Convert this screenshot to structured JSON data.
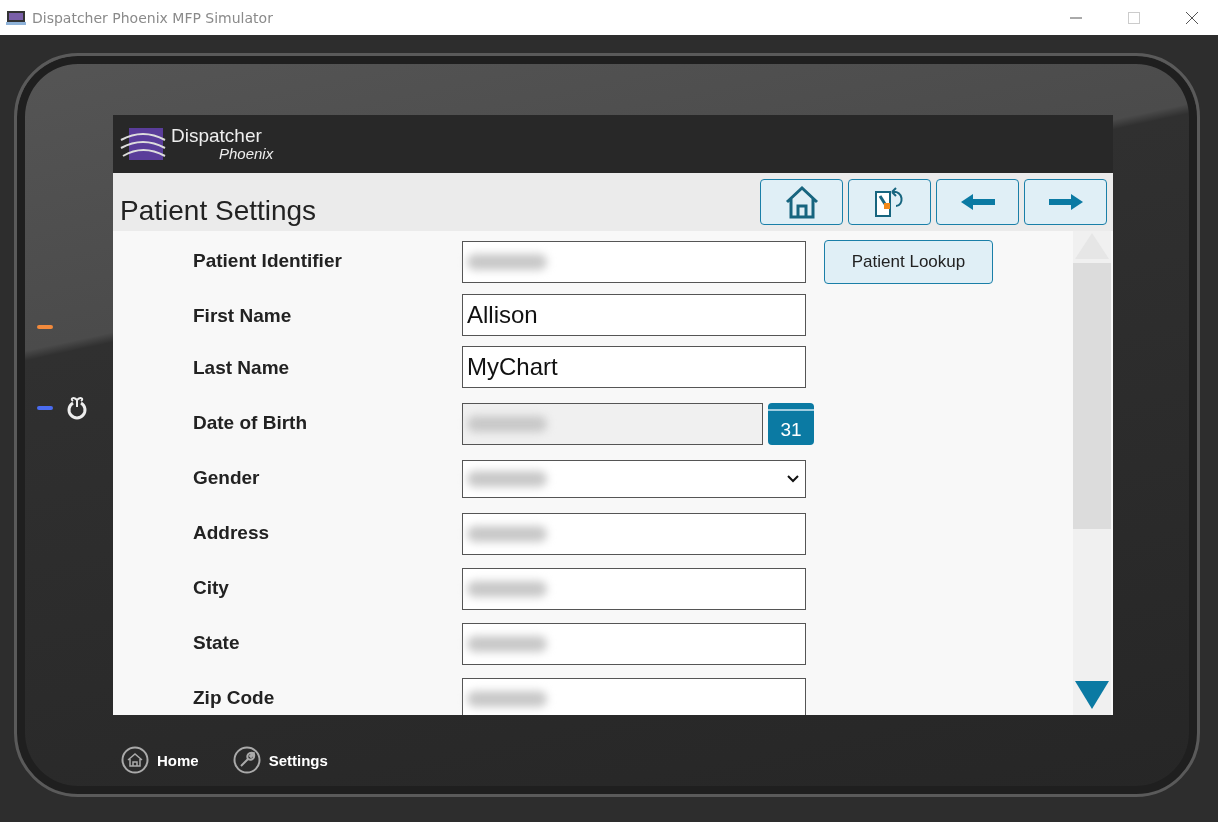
{
  "window": {
    "title": "Dispatcher Phoenix MFP Simulator"
  },
  "brand": {
    "name": "Dispatcher",
    "subname": "Phoenix"
  },
  "page": {
    "title": "Patient Settings"
  },
  "toolbar": [
    {
      "kind": "home"
    },
    {
      "kind": "return"
    },
    {
      "kind": "back"
    },
    {
      "kind": "forward"
    }
  ],
  "form": {
    "fields": [
      {
        "label": "Patient Identifier",
        "kind": "text",
        "redacted": true,
        "action": "Patient Lookup"
      },
      {
        "label": "First Name",
        "kind": "text",
        "redacted": false,
        "value": "Allison"
      },
      {
        "label": "Last Name",
        "kind": "text",
        "redacted": false,
        "value": "MyChart"
      },
      {
        "label": "Date of Birth",
        "kind": "date",
        "redacted": true,
        "calendar_day": "31"
      },
      {
        "label": "Gender",
        "kind": "select",
        "redacted": true
      },
      {
        "label": "Address",
        "kind": "text",
        "redacted": true
      },
      {
        "label": "City",
        "kind": "text",
        "redacted": true
      },
      {
        "label": "State",
        "kind": "text",
        "redacted": true
      },
      {
        "label": "Zip Code",
        "kind": "text",
        "redacted": true
      }
    ]
  },
  "bottom_nav": [
    {
      "label": "Home",
      "kind": "home"
    },
    {
      "label": "Settings",
      "kind": "settings"
    }
  ]
}
